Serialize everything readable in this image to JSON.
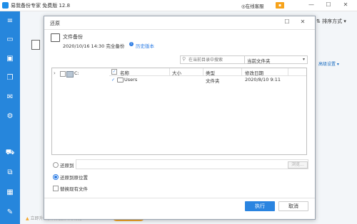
{
  "app": {
    "title": "易我备份专家 免费版 12.8",
    "help": "在线客服",
    "cart_icon": "cart-icon",
    "minimize": "—",
    "maximize": "☐",
    "close": "✕"
  },
  "main": {
    "sort_label": "排序方式",
    "advanced_settings": "高级设置",
    "promo_text": "立即升级获得更强大的功能",
    "promo_button": "立即升级"
  },
  "dialog": {
    "title": "还原",
    "maximize": "☐",
    "close": "✕",
    "backup_name": "文件备份",
    "backup_date": "2020/10/16 14:30 完全备份",
    "history_link": "历史版本",
    "search_placeholder": "在当前目录中搜索",
    "filter_value": "当前文件夹",
    "tree": [
      {
        "label": "C:"
      }
    ],
    "list": {
      "columns": [
        "名称",
        "大小",
        "类型",
        "修改日期"
      ],
      "rows": [
        {
          "name": "Users",
          "size": "",
          "type": "文件夹",
          "modified": "2020/8/10 9:11"
        }
      ]
    },
    "options": {
      "restore_to": "还原到",
      "restore_original": "还原到原位置",
      "replace_existing": "替换现有文件",
      "browse": "浏览..."
    },
    "buttons": {
      "run": "执行",
      "cancel": "取消"
    }
  },
  "colors": {
    "sidebar": "#2686dc",
    "accent": "#2a84e0",
    "promo": "#f4a62a"
  }
}
